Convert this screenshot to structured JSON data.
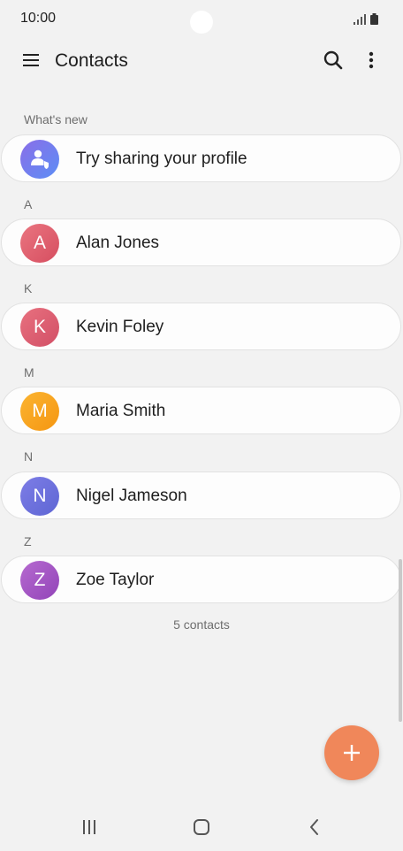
{
  "status_bar": {
    "time": "10:00"
  },
  "app_bar": {
    "title": "Contacts",
    "menu_icon": "hamburger-menu-icon",
    "search_icon": "search-icon",
    "more_icon": "more-vertical-icon"
  },
  "whats_new": {
    "label": "What's new",
    "item": {
      "label": "Try sharing your profile",
      "icon": "share-profile-icon",
      "color": "#6f7ff0"
    }
  },
  "groups": [
    {
      "letter": "A",
      "contact": {
        "name": "Alan Jones",
        "initial": "A",
        "color": "#e0606e"
      }
    },
    {
      "letter": "K",
      "contact": {
        "name": "Kevin Foley",
        "initial": "K",
        "color": "#dd5f72"
      }
    },
    {
      "letter": "M",
      "contact": {
        "name": "Maria Smith",
        "initial": "M",
        "color": "#f7a21a"
      }
    },
    {
      "letter": "N",
      "contact": {
        "name": "Nigel Jameson",
        "initial": "N",
        "color": "#6d6fdb"
      }
    },
    {
      "letter": "Z",
      "contact": {
        "name": "Zoe Taylor",
        "initial": "Z",
        "color": "#a357c4"
      }
    }
  ],
  "footer": {
    "count": "5 contacts"
  },
  "fab": {
    "icon": "plus-icon",
    "color": "#f0875a"
  },
  "nav_bar": {
    "recents_icon": "recent-apps-icon",
    "home_icon": "home-icon",
    "back_icon": "back-icon"
  }
}
